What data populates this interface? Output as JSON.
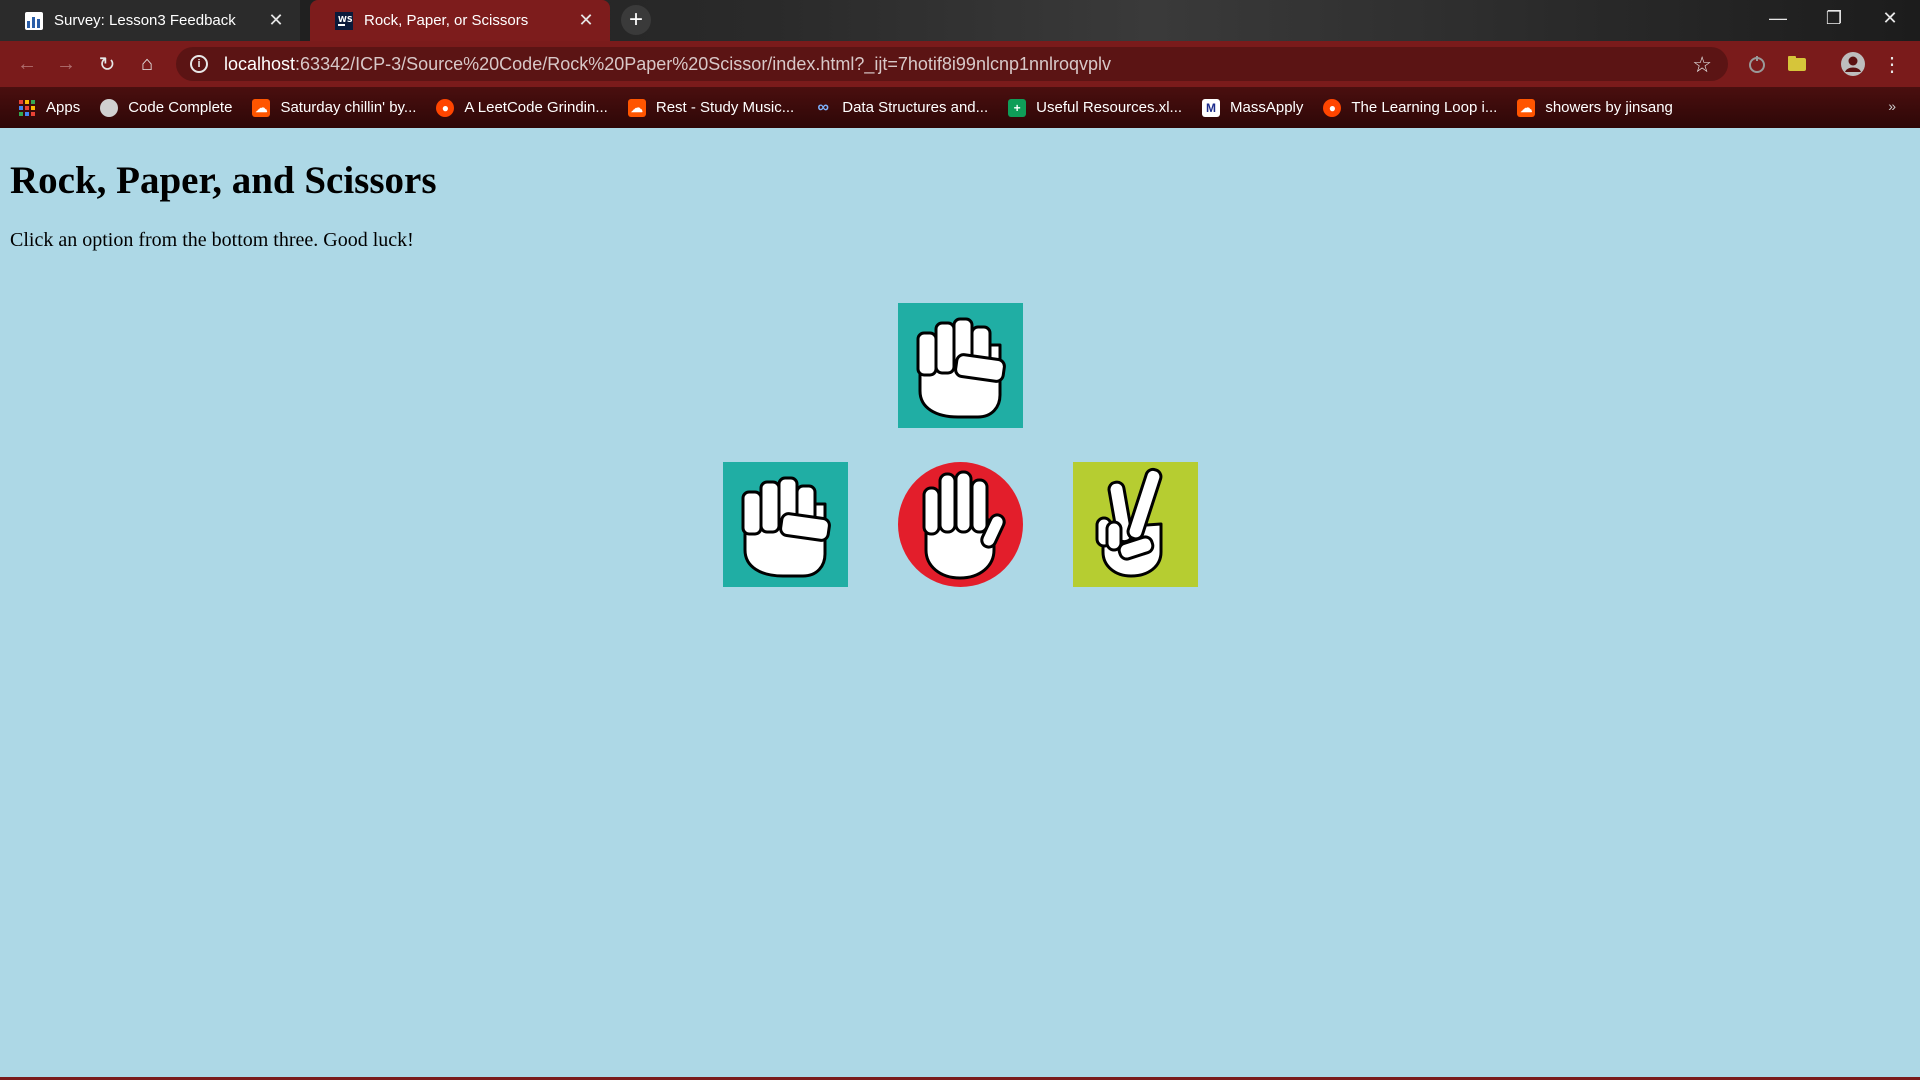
{
  "browser": {
    "tabs": [
      {
        "title": "Survey: Lesson3 Feedback",
        "active": false
      },
      {
        "title": "Rock, Paper, or Scissors",
        "active": true
      }
    ],
    "address": {
      "host": "localhost",
      "rest": ":63342/ICP-3/Source%20Code/Rock%20Paper%20Scissor/index.html?_ijt=7hotif8i99nlcnp1nnlroqvplv"
    },
    "bookmarks": [
      {
        "label": "Apps",
        "icon": "apps-grid-icon"
      },
      {
        "label": "Code Complete",
        "icon": "globe-icon"
      },
      {
        "label": "Saturday chillin' by...",
        "icon": "soundcloud-icon"
      },
      {
        "label": "A LeetCode Grindin...",
        "icon": "reddit-icon"
      },
      {
        "label": "Rest - Study Music...",
        "icon": "soundcloud-icon"
      },
      {
        "label": "Data Structures and...",
        "icon": "infinity-icon"
      },
      {
        "label": "Useful Resources.xl...",
        "icon": "sheets-plus-icon"
      },
      {
        "label": "MassApply",
        "icon": "massapply-icon"
      },
      {
        "label": "The Learning Loop i...",
        "icon": "reddit-icon"
      },
      {
        "label": "showers by jinsang",
        "icon": "soundcloud-icon"
      }
    ],
    "more_bookmarks": "»"
  },
  "page": {
    "title": "Rock, Paper, and Scissors",
    "instructions": "Click an option from the bottom three. Good luck!",
    "computer_choice": "rock",
    "options": [
      "rock",
      "paper",
      "scissors"
    ]
  },
  "colors": {
    "page_bg": "#add8e6",
    "rock_bg": "#20aea4",
    "paper_bg": "#e31e2b",
    "scissors_bg": "#b6cd31"
  }
}
